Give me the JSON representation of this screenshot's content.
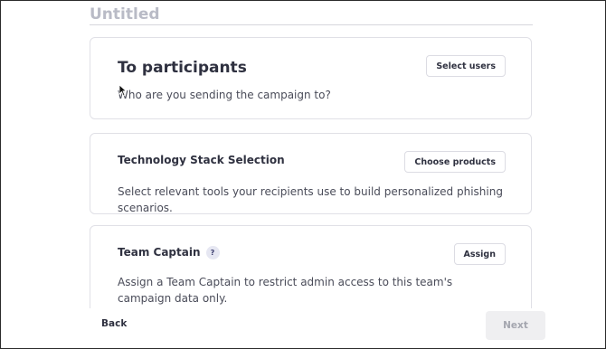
{
  "campaign": {
    "title_placeholder": "Untitled"
  },
  "cards": [
    {
      "title": "To participants",
      "description": "Who are you sending the campaign to?",
      "button_label": "Select users"
    },
    {
      "title": "Technology Stack Selection",
      "description": "Select relevant tools your recipients use to build personalized phishing scenarios.",
      "button_label": "Choose products"
    },
    {
      "title": "Team Captain",
      "help_label": "?",
      "description": "Assign a Team Captain to restrict admin access to this team's campaign data only.",
      "button_label": "Assign"
    }
  ],
  "footer": {
    "back_label": "Back",
    "next_label": "Next"
  }
}
